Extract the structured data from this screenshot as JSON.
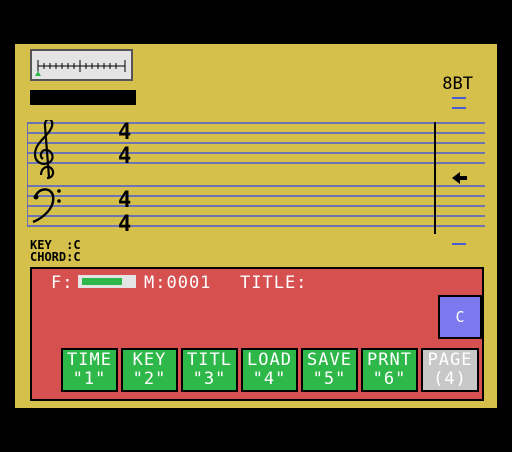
{
  "header": {
    "speed_label": "8BT"
  },
  "staff": {
    "treble_time": {
      "top": "4",
      "bottom": "4"
    },
    "bass_time": {
      "top": "4",
      "bottom": "4"
    }
  },
  "status": {
    "key_label": "KEY  :C",
    "chord_label": "CHORD:C"
  },
  "panel": {
    "f_label": "F:",
    "fill_level": 0.8,
    "measure_label": "M:0001",
    "title_label": "TITLE:",
    "current_key_button": "C"
  },
  "function_keys": [
    {
      "name": "TIME",
      "key": "\"1\""
    },
    {
      "name": "KEY",
      "key": "\"2\""
    },
    {
      "name": "TITL",
      "key": "\"3\""
    },
    {
      "name": "LOAD",
      "key": "\"4\""
    },
    {
      "name": "SAVE",
      "key": "\"5\""
    },
    {
      "name": "PRNT",
      "key": "\"6\""
    },
    {
      "name": "PAGE",
      "key": "(4)"
    }
  ],
  "colors": {
    "background": "#d4c04a",
    "panel": "#d65050",
    "key_green": "#2fb84a",
    "key_page": "#c8c8c8",
    "staff_line": "#4a5bd6",
    "current_key_button": "#7c78ee"
  },
  "icons": {
    "cursor": "left-arrow-icon",
    "treble": "treble-clef-icon",
    "bass": "bass-clef-icon"
  }
}
